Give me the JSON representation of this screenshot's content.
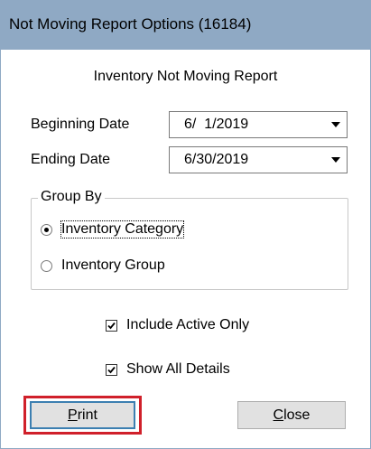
{
  "window": {
    "title": "Not Moving Report Options (16184)"
  },
  "report": {
    "heading": "Inventory Not Moving Report"
  },
  "fields": {
    "beginning_date": {
      "label": "Beginning Date",
      "value": "6/  1/2019"
    },
    "ending_date": {
      "label": "Ending Date",
      "value": "6/30/2019"
    }
  },
  "group_by": {
    "legend": "Group By",
    "options": [
      {
        "label": "Inventory Category",
        "selected": true
      },
      {
        "label": "Inventory Group",
        "selected": false
      }
    ]
  },
  "options": {
    "include_active_only": {
      "label": "Include Active Only",
      "checked": true
    },
    "show_all_details": {
      "label": "Show All Details",
      "checked": true
    }
  },
  "buttons": {
    "print": {
      "accel": "P",
      "rest": "rint"
    },
    "close": {
      "accel": "C",
      "rest": "lose"
    }
  },
  "colors": {
    "titlebar": "#8fa9c4",
    "highlight": "#d0202a",
    "focus_border": "#3c7fb1"
  },
  "icons": {
    "dropdown": "chevron-down-icon",
    "check": "checkmark-icon"
  }
}
